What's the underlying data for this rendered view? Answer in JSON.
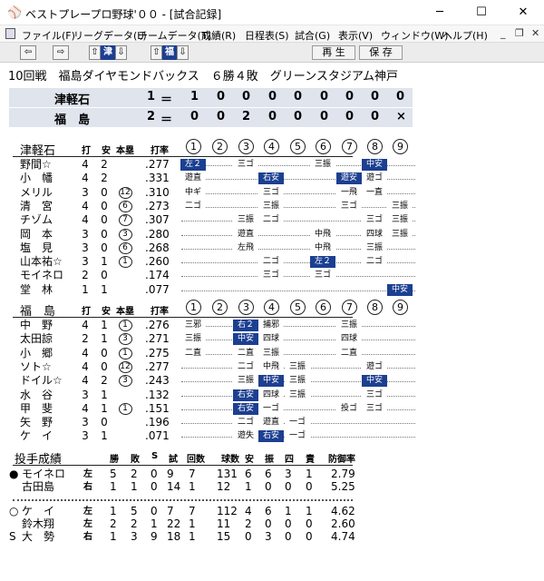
{
  "window": {
    "title": "ベストプレープロ野球'００ - [試合記録]",
    "minimize": "─",
    "maximize": "☐",
    "close": "✕"
  },
  "menu": [
    "ファイル(F)",
    "リーグデータ(L)",
    "チームデータ(T)",
    "成績(R)",
    "日程表(S)",
    "試合(G)",
    "表示(V)",
    "ウィンドウ(W)",
    "ヘルプ(H)"
  ],
  "mdi": {
    "min": "_",
    "restore": "❐",
    "close": "✕"
  },
  "toolbar": {
    "prev": "⇦",
    "next": "⇨",
    "up1": "⇧",
    "team1": "津",
    "down1": "⇩",
    "up2": "⇧",
    "team2": "福",
    "down2": "⇩",
    "replay": "再 生",
    "save": "保 存"
  },
  "header": "10回戦　福島ダイヤモンドバックス　６勝４敗　グリーンスタジアム神戸",
  "linescore": [
    {
      "team": "津軽石",
      "order": "1",
      "eq": "＝",
      "innings": [
        "1",
        "0",
        "0",
        "0",
        "0",
        "0",
        "0",
        "0",
        "0"
      ]
    },
    {
      "team": "福　島",
      "order": "2",
      "eq": "＝",
      "innings": [
        "0",
        "0",
        "2",
        "0",
        "0",
        "0",
        "0",
        "0",
        "×"
      ]
    }
  ],
  "cols": {
    "pa": "打",
    "h": "安",
    "hr": "本塁",
    "avg": "打率"
  },
  "innings_hdr": [
    "1",
    "2",
    "3",
    "4",
    "5",
    "6",
    "7",
    "8",
    "9"
  ],
  "team1": {
    "name": "津軽石",
    "players": [
      {
        "name": "野間☆",
        "ab": "4",
        "h": "2",
        "hr": "",
        "avg": ".277",
        "res": [
          [
            "左２",
            1
          ],
          [
            "三ゴ",
            0
          ],
          [
            "",
            0
          ],
          [
            "三振",
            0
          ],
          [
            "",
            0
          ],
          [
            "中安",
            1
          ],
          [
            "",
            0
          ]
        ]
      },
      {
        "name": "小　幡",
        "ab": "4",
        "h": "2",
        "hr": "",
        "avg": ".331",
        "res": [
          [
            "遊直",
            0
          ],
          [
            "",
            0
          ],
          [
            "右安",
            1
          ],
          [
            "",
            0
          ],
          [
            "遊安",
            1
          ],
          [
            "遊ゴ",
            0
          ],
          [
            "",
            0
          ]
        ]
      },
      {
        "name": "メリル",
        "ab": "3",
        "h": "0",
        "hr": "12",
        "avg": ".310",
        "res": [
          [
            "中ギ",
            0
          ],
          [
            "",
            0
          ],
          [
            "三ゴ",
            0
          ],
          [
            "",
            0
          ],
          [
            "一飛",
            0
          ],
          [
            "一直",
            0
          ],
          [
            "",
            0
          ]
        ]
      },
      {
        "name": "清　宮",
        "ab": "4",
        "h": "0",
        "hr": "6",
        "avg": ".273",
        "res": [
          [
            "二ゴ",
            0
          ],
          [
            "",
            0
          ],
          [
            "三振",
            0
          ],
          [
            "",
            0
          ],
          [
            "三ゴ",
            0
          ],
          [
            "",
            0
          ],
          [
            "三振",
            0
          ]
        ]
      },
      {
        "name": "チゾム",
        "ab": "4",
        "h": "0",
        "hr": "7",
        "avg": ".307",
        "res": [
          [
            "",
            0
          ],
          [
            "三振",
            0
          ],
          [
            "二ゴ",
            0
          ],
          [
            "",
            0
          ],
          [
            "",
            0
          ],
          [
            "三ゴ",
            0
          ],
          [
            "三振",
            0
          ]
        ]
      },
      {
        "name": "岡　本",
        "ab": "3",
        "h": "0",
        "hr": "3",
        "avg": ".280",
        "res": [
          [
            "",
            0
          ],
          [
            "遊直",
            0
          ],
          [
            "",
            0
          ],
          [
            "中飛",
            0
          ],
          [
            "",
            0
          ],
          [
            "四球",
            0
          ],
          [
            "三振",
            0
          ]
        ]
      },
      {
        "name": "塩　見",
        "ab": "3",
        "h": "0",
        "hr": "6",
        "avg": ".268",
        "res": [
          [
            "",
            0
          ],
          [
            "左飛",
            0
          ],
          [
            "",
            0
          ],
          [
            "中飛",
            0
          ],
          [
            "",
            0
          ],
          [
            "三振",
            0
          ],
          [
            "",
            0
          ]
        ]
      },
      {
        "name": "山本祐☆",
        "ab": "3",
        "h": "1",
        "hr": "1",
        "avg": ".260",
        "res": [
          [
            "",
            0
          ],
          [
            "",
            0
          ],
          [
            "二ゴ",
            0
          ],
          [
            "左２",
            1
          ],
          [
            "",
            0
          ],
          [
            "二ゴ",
            0
          ],
          [
            "",
            0
          ]
        ]
      },
      {
        "name": "モイネロ",
        "ab": "2",
        "h": "0",
        "hr": "",
        "avg": ".174",
        "res": [
          [
            "",
            0
          ],
          [
            "",
            0
          ],
          [
            "三ゴ",
            0
          ],
          [
            "三ゴ",
            0
          ],
          [
            "",
            0
          ],
          [
            "",
            0
          ],
          [
            "",
            0
          ]
        ]
      },
      {
        "name": "堂　林",
        "ab": "1",
        "h": "1",
        "hr": "",
        "avg": ".077",
        "res": [
          [
            "",
            0
          ],
          [
            "",
            0
          ],
          [
            "",
            0
          ],
          [
            "",
            0
          ],
          [
            "",
            0
          ],
          [
            "",
            0
          ],
          [
            "中安",
            1
          ]
        ]
      }
    ]
  },
  "team2": {
    "name": "福　島",
    "players": [
      {
        "name": "中　野",
        "ab": "4",
        "h": "1",
        "hr": "1",
        "avg": ".276",
        "res": [
          [
            "三邪",
            0
          ],
          [
            "右２",
            1
          ],
          [
            "捕邪",
            0
          ],
          [
            "",
            0
          ],
          [
            "三振",
            0
          ],
          [
            "",
            0
          ],
          [
            "",
            0
          ]
        ]
      },
      {
        "name": "太田諒",
        "ab": "2",
        "h": "1",
        "hr": "3",
        "avg": ".271",
        "res": [
          [
            "三振",
            0
          ],
          [
            "中安",
            1
          ],
          [
            "四球",
            0
          ],
          [
            "",
            0
          ],
          [
            "四球",
            0
          ],
          [
            "",
            0
          ],
          [
            "",
            0
          ]
        ]
      },
      {
        "name": "小　郷",
        "ab": "4",
        "h": "0",
        "hr": "1",
        "avg": ".275",
        "res": [
          [
            "二直",
            0
          ],
          [
            "二直",
            0
          ],
          [
            "三振",
            0
          ],
          [
            "",
            0
          ],
          [
            "二直",
            0
          ],
          [
            "",
            0
          ],
          [
            "",
            0
          ]
        ]
      },
      {
        "name": "ソト☆",
        "ab": "4",
        "h": "0",
        "hr": "12",
        "avg": ".277",
        "res": [
          [
            "",
            0
          ],
          [
            "二ゴ",
            0
          ],
          [
            "中飛",
            0
          ],
          [
            "三振",
            0
          ],
          [
            "",
            0
          ],
          [
            "遊ゴ",
            0
          ],
          [
            "",
            0
          ]
        ]
      },
      {
        "name": "ドイル☆",
        "ab": "4",
        "h": "2",
        "hr": "3",
        "avg": ".243",
        "res": [
          [
            "",
            0
          ],
          [
            "三振",
            0
          ],
          [
            "中安",
            1
          ],
          [
            "三振",
            0
          ],
          [
            "",
            0
          ],
          [
            "中安",
            1
          ],
          [
            "",
            0
          ]
        ]
      },
      {
        "name": "水　谷",
        "ab": "3",
        "h": "1",
        "hr": "",
        "avg": ".132",
        "res": [
          [
            "",
            0
          ],
          [
            "右安",
            1
          ],
          [
            "四球",
            0
          ],
          [
            "三振",
            0
          ],
          [
            "",
            0
          ],
          [
            "三ゴ",
            0
          ],
          [
            "",
            0
          ]
        ]
      },
      {
        "name": "甲　斐",
        "ab": "4",
        "h": "1",
        "hr": "1",
        "avg": ".151",
        "res": [
          [
            "",
            0
          ],
          [
            "右安",
            1
          ],
          [
            "一ゴ",
            0
          ],
          [
            "",
            0
          ],
          [
            "投ゴ",
            0
          ],
          [
            "三ゴ",
            0
          ],
          [
            "",
            0
          ]
        ]
      },
      {
        "name": "矢　野",
        "ab": "3",
        "h": "0",
        "hr": "",
        "avg": ".196",
        "res": [
          [
            "",
            0
          ],
          [
            "二ゴ",
            0
          ],
          [
            "遊直",
            0
          ],
          [
            "一ゴ",
            0
          ],
          [
            "",
            0
          ],
          [
            "",
            0
          ],
          [
            "",
            0
          ]
        ]
      },
      {
        "name": "ケ　イ",
        "ab": "3",
        "h": "1",
        "hr": "",
        "avg": ".071",
        "res": [
          [
            "",
            0
          ],
          [
            "遊失",
            0
          ],
          [
            "右安",
            1
          ],
          [
            "一ゴ",
            0
          ],
          [
            "",
            0
          ],
          [
            "",
            0
          ],
          [
            "",
            0
          ]
        ]
      }
    ]
  },
  "pitching": {
    "title": "投手成績",
    "cols": [
      "勝",
      "敗",
      "S",
      "試",
      "回数",
      "球数",
      "安",
      "振",
      "四",
      "責",
      "防御率"
    ],
    "team1": [
      {
        "mark": "●",
        "name": "モイネロ",
        "hand": "左",
        "v": [
          "5",
          "2",
          "0",
          "9",
          "7",
          "131",
          "6",
          "6",
          "3",
          "1",
          "2.79"
        ]
      },
      {
        "mark": "",
        "name": "古田島",
        "hand": "右",
        "v": [
          "1",
          "1",
          "0",
          "14",
          "1",
          "12",
          "1",
          "0",
          "0",
          "0",
          "5.25"
        ]
      }
    ],
    "team2": [
      {
        "mark": "○",
        "name": "ケ　イ",
        "hand": "左",
        "v": [
          "1",
          "5",
          "0",
          "7",
          "7",
          "112",
          "4",
          "6",
          "1",
          "1",
          "4.62"
        ]
      },
      {
        "mark": "",
        "name": "鈴木翔",
        "hand": "左",
        "v": [
          "2",
          "2",
          "1",
          "22",
          "1",
          "11",
          "2",
          "0",
          "0",
          "0",
          "2.60"
        ]
      },
      {
        "mark": "S",
        "name": "大　勢",
        "hand": "右",
        "v": [
          "1",
          "3",
          "9",
          "18",
          "1",
          "15",
          "0",
          "3",
          "0",
          "0",
          "4.74"
        ]
      }
    ]
  }
}
